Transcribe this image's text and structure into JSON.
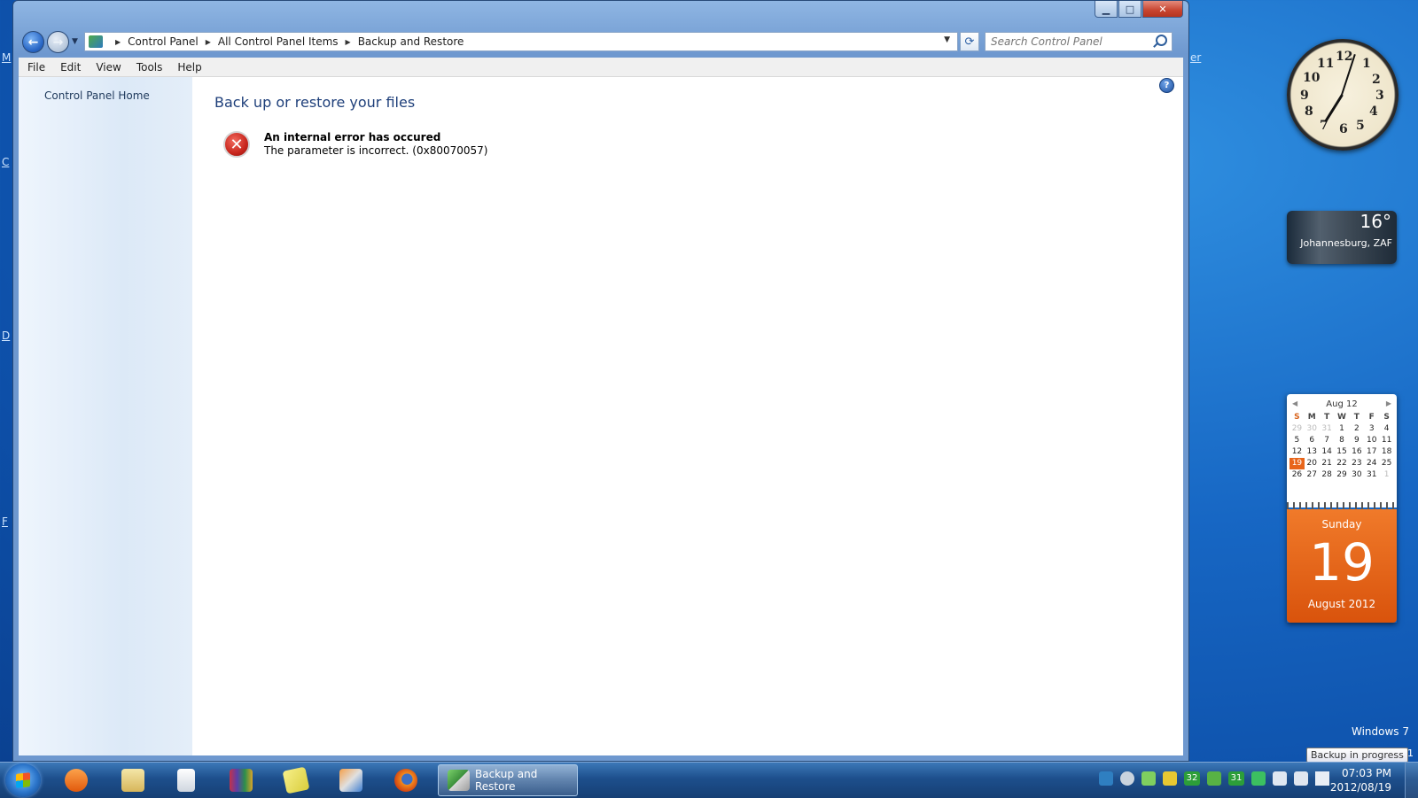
{
  "window": {
    "caption_buttons": {
      "minimize": "▁",
      "maximize": "□",
      "close": "✕"
    }
  },
  "navigation": {
    "breadcrumb": [
      "Control Panel",
      "All Control Panel Items",
      "Backup and Restore"
    ],
    "search_placeholder": "Search Control Panel"
  },
  "menu": [
    "File",
    "Edit",
    "View",
    "Tools",
    "Help"
  ],
  "sidebar": {
    "home_link": "Control Panel Home"
  },
  "main": {
    "title": "Back up or restore your files",
    "error_title": "An internal error has occured",
    "error_message": "The parameter is incorrect. (0x80070057)"
  },
  "gadgets": {
    "clock": {
      "numbers": [
        "12",
        "1",
        "2",
        "3",
        "4",
        "5",
        "6",
        "7",
        "8",
        "9",
        "10",
        "11"
      ],
      "time": "07:03"
    },
    "weather": {
      "temperature": "16°",
      "city": "Johannesburg, ZAF"
    },
    "calendar": {
      "month_label": "Aug 12",
      "weekday_headers": [
        "S",
        "M",
        "T",
        "W",
        "T",
        "F",
        "S"
      ],
      "days": [
        [
          "29",
          "30",
          "31",
          "1",
          "2",
          "3",
          "4"
        ],
        [
          "5",
          "6",
          "7",
          "8",
          "9",
          "10",
          "11"
        ],
        [
          "12",
          "13",
          "14",
          "15",
          "16",
          "17",
          "18"
        ],
        [
          "19",
          "20",
          "21",
          "22",
          "23",
          "24",
          "25"
        ],
        [
          "26",
          "27",
          "28",
          "29",
          "30",
          "31",
          "1"
        ]
      ],
      "today": "19",
      "weekday": "Sunday",
      "day_number": "19",
      "month_year": "August 2012"
    }
  },
  "desktop": {
    "watermark": "Windows 7",
    "tooltip": "Backup in progress",
    "tooltip_edge": "1"
  },
  "taskbar": {
    "active_window_label": "Backup and Restore",
    "time": "07:03 PM",
    "date": "2012/08/19",
    "tray_numbers": [
      "32",
      "31"
    ]
  }
}
